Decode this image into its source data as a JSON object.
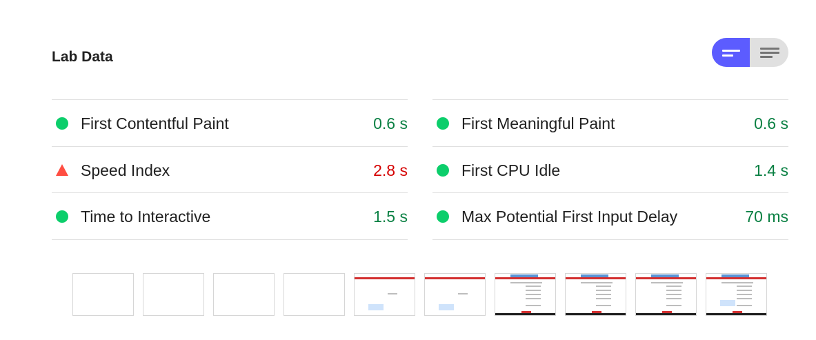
{
  "section": {
    "title": "Lab Data"
  },
  "view_toggle": {
    "options": [
      {
        "icon": "collapsed-lines-icon",
        "active": true
      },
      {
        "icon": "expanded-lines-icon",
        "active": false
      }
    ],
    "active_color": "#5c5cff",
    "inactive_color": "#e0e0e0"
  },
  "metrics": {
    "left": [
      {
        "label": "First Contentful Paint",
        "value": "0.6 s",
        "status": "pass",
        "indicator": "green-circle-icon"
      },
      {
        "label": "Speed Index",
        "value": "2.8 s",
        "status": "fail",
        "indicator": "red-triangle-icon"
      },
      {
        "label": "Time to Interactive",
        "value": "1.5 s",
        "status": "pass",
        "indicator": "green-circle-icon"
      }
    ],
    "right": [
      {
        "label": "First Meaningful Paint",
        "value": "0.6 s",
        "status": "pass",
        "indicator": "green-circle-icon"
      },
      {
        "label": "First CPU Idle",
        "value": "1.4 s",
        "status": "pass",
        "indicator": "green-circle-icon"
      },
      {
        "label": "Max Potential First Input Delay",
        "value": "70 ms",
        "status": "pass",
        "indicator": "green-circle-icon"
      }
    ]
  },
  "colors": {
    "pass_text": "#0a8043",
    "pass_indicator": "#0cce6b",
    "fail_text": "#d50000",
    "fail_indicator": "#ff4e42"
  },
  "filmstrip": {
    "frames": [
      "blank",
      "blank",
      "blank",
      "blank",
      "header-only",
      "header-only",
      "full-page",
      "full-page",
      "full-page",
      "full-page"
    ]
  }
}
